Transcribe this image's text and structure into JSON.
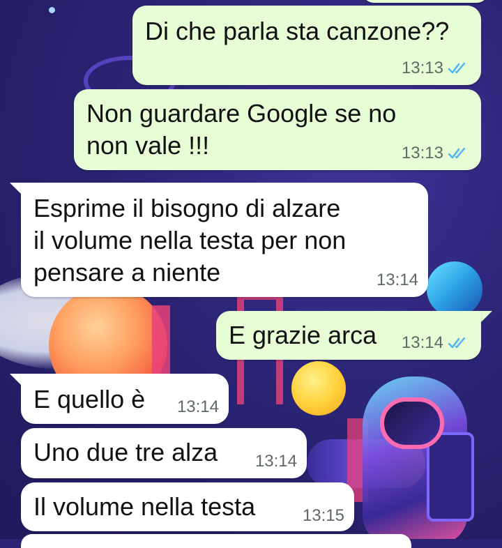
{
  "messages": [
    {
      "direction": "out",
      "lines": [
        "Di che parla sta canzone??"
      ],
      "time": "13:13",
      "read": true
    },
    {
      "direction": "out",
      "lines": [
        "Non guardare Google se no",
        "non vale !!!"
      ],
      "time": "13:13",
      "read": true
    },
    {
      "direction": "in",
      "lines": [
        "Esprime il bisogno di alzare",
        "il volume nella testa per non",
        "pensare a niente"
      ],
      "time": "13:14"
    },
    {
      "direction": "out",
      "lines": [
        "E grazie arca"
      ],
      "time": "13:14",
      "read": true
    },
    {
      "direction": "in",
      "lines": [
        "E quello è"
      ],
      "time": "13:14"
    },
    {
      "direction": "in",
      "lines": [
        "Uno due tre alza"
      ],
      "time": "13:14"
    },
    {
      "direction": "in",
      "lines": [
        "Il volume nella testa"
      ],
      "time": "13:15"
    }
  ],
  "icons": {
    "read_receipt": "double-check-icon"
  },
  "colors": {
    "outgoing_bubble": "#e7fdd6",
    "incoming_bubble": "#ffffff",
    "read_tick": "#4fb3f6",
    "wallpaper": "#2b2474"
  }
}
